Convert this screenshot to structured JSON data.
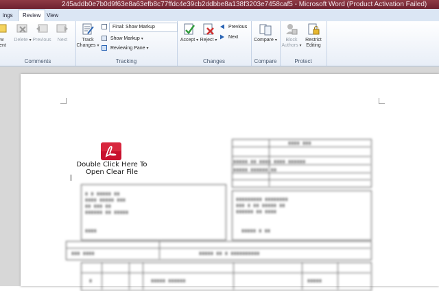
{
  "window": {
    "title": "245addb0e7b0d9f63e8a63efb8c77ffdc4e39cb2ddbbe8a138f3203e7458caf5 - Microsoft Word (Product Activation Failed)"
  },
  "tabs": [
    {
      "label": "ings"
    },
    {
      "label": "Review"
    },
    {
      "label": "View"
    }
  ],
  "ribbon": {
    "comments": {
      "new_label": "ew\nment",
      "delete_label": "Delete",
      "previous_label": "Previous",
      "next_label": "Next",
      "group_label": "Comments"
    },
    "tracking": {
      "track_changes_label": "Track\nChanges",
      "final_show_markup": "Final: Show Markup",
      "show_markup": "Show Markup",
      "reviewing_pane": "Reviewing Pane",
      "group_label": "Tracking"
    },
    "changes": {
      "accept_label": "Accept",
      "reject_label": "Reject",
      "previous_label": "Previous",
      "next_label": "Next",
      "group_label": "Changes"
    },
    "compare": {
      "compare_label": "Compare",
      "group_label": "Compare"
    },
    "protect": {
      "block_authors_label": "Block\nAuthors",
      "restrict_editing_label": "Restrict\nEditing",
      "group_label": "Protect"
    }
  },
  "document": {
    "attachment_label_line1": "Double Click Here To",
    "attachment_label_line2": "Open Clear File"
  },
  "colors": {
    "title_bar": "#7a2a3a",
    "ribbon_bg": "#e8eef7",
    "doc_bg": "#d7d7d7",
    "attachment_red": "#c8102e"
  }
}
